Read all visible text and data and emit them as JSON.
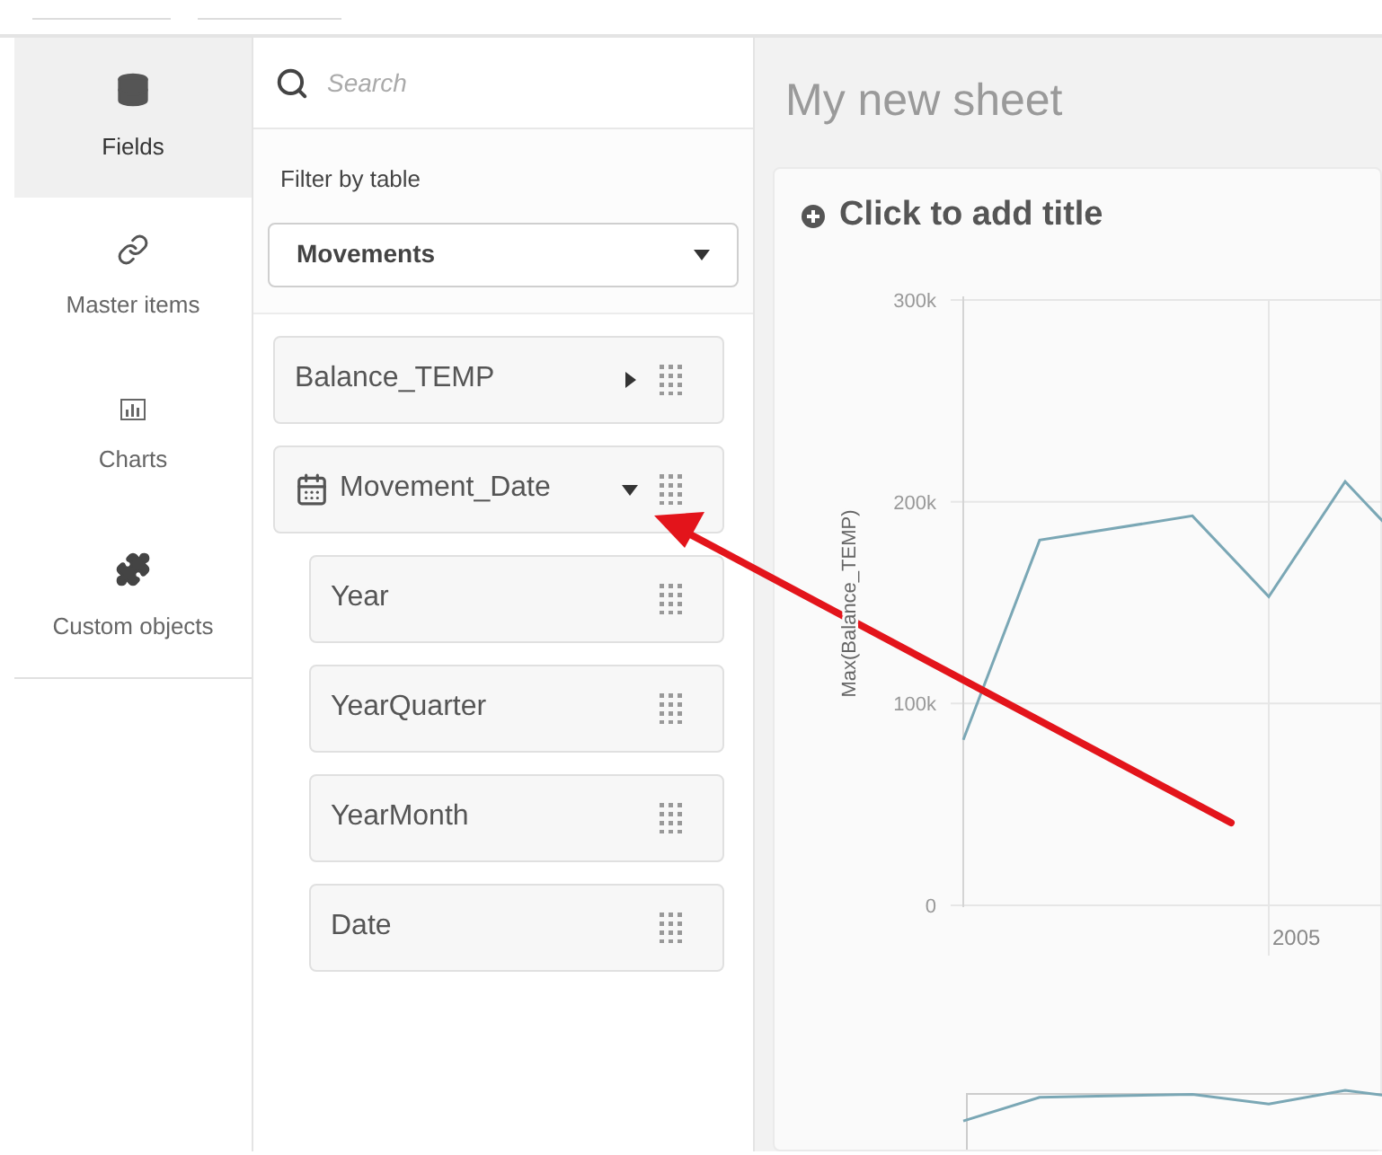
{
  "nav_items": [
    {
      "label": "Fields",
      "selected": true
    },
    {
      "label": "Master items",
      "selected": false
    },
    {
      "label": "Charts",
      "selected": false
    },
    {
      "label": "Custom objects",
      "selected": false
    }
  ],
  "search": {
    "placeholder": "Search"
  },
  "filter": {
    "label": "Filter by table",
    "value": "Movements"
  },
  "fields": [
    {
      "name": "Balance_TEMP",
      "kind": "plain",
      "expanded": false
    },
    {
      "name": "Movement_Date",
      "kind": "date",
      "expanded": true,
      "children": [
        {
          "name": "Year"
        },
        {
          "name": "YearQuarter"
        },
        {
          "name": "YearMonth"
        },
        {
          "name": "Date"
        }
      ]
    }
  ],
  "sheet": {
    "title": "My new sheet",
    "card_title": "Click to add title",
    "chart": {
      "y_axis_title": "Max(Balance_TEMP)",
      "y_axis_labels": [
        "300k",
        "200k",
        "100k",
        "0"
      ],
      "x_axis_labels": [
        "2005"
      ]
    }
  }
}
